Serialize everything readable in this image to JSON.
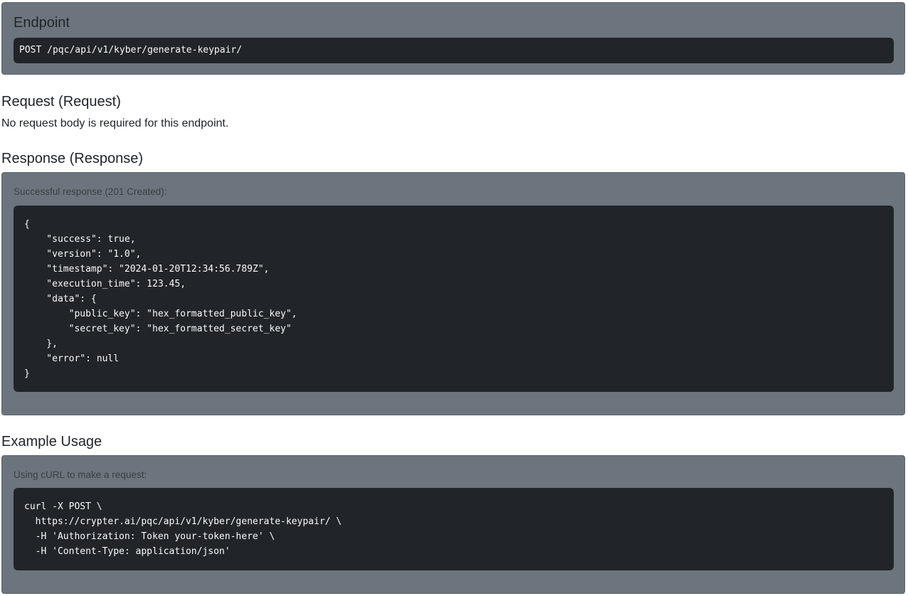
{
  "endpoint": {
    "title": "Endpoint",
    "code": "POST /pqc/api/v1/kyber/generate-keypair/"
  },
  "request": {
    "heading": "Request (Request)",
    "text": "No request body is required for this endpoint."
  },
  "response": {
    "heading": "Response (Response)",
    "caption": "Successful response (201 Created):",
    "code": "{\n    \"success\": true,\n    \"version\": \"1.0\",\n    \"timestamp\": \"2024-01-20T12:34:56.789Z\",\n    \"execution_time\": 123.45,\n    \"data\": {\n        \"public_key\": \"hex_formatted_public_key\",\n        \"secret_key\": \"hex_formatted_secret_key\"\n    },\n    \"error\": null\n}"
  },
  "example": {
    "heading": "Example Usage",
    "caption": "Using cURL to make a request:",
    "code": "curl -X POST \\\n  https://crypter.ai/pqc/api/v1/kyber/generate-keypair/ \\\n  -H 'Authorization: Token your-token-here' \\\n  -H 'Content-Type: application/json'"
  }
}
